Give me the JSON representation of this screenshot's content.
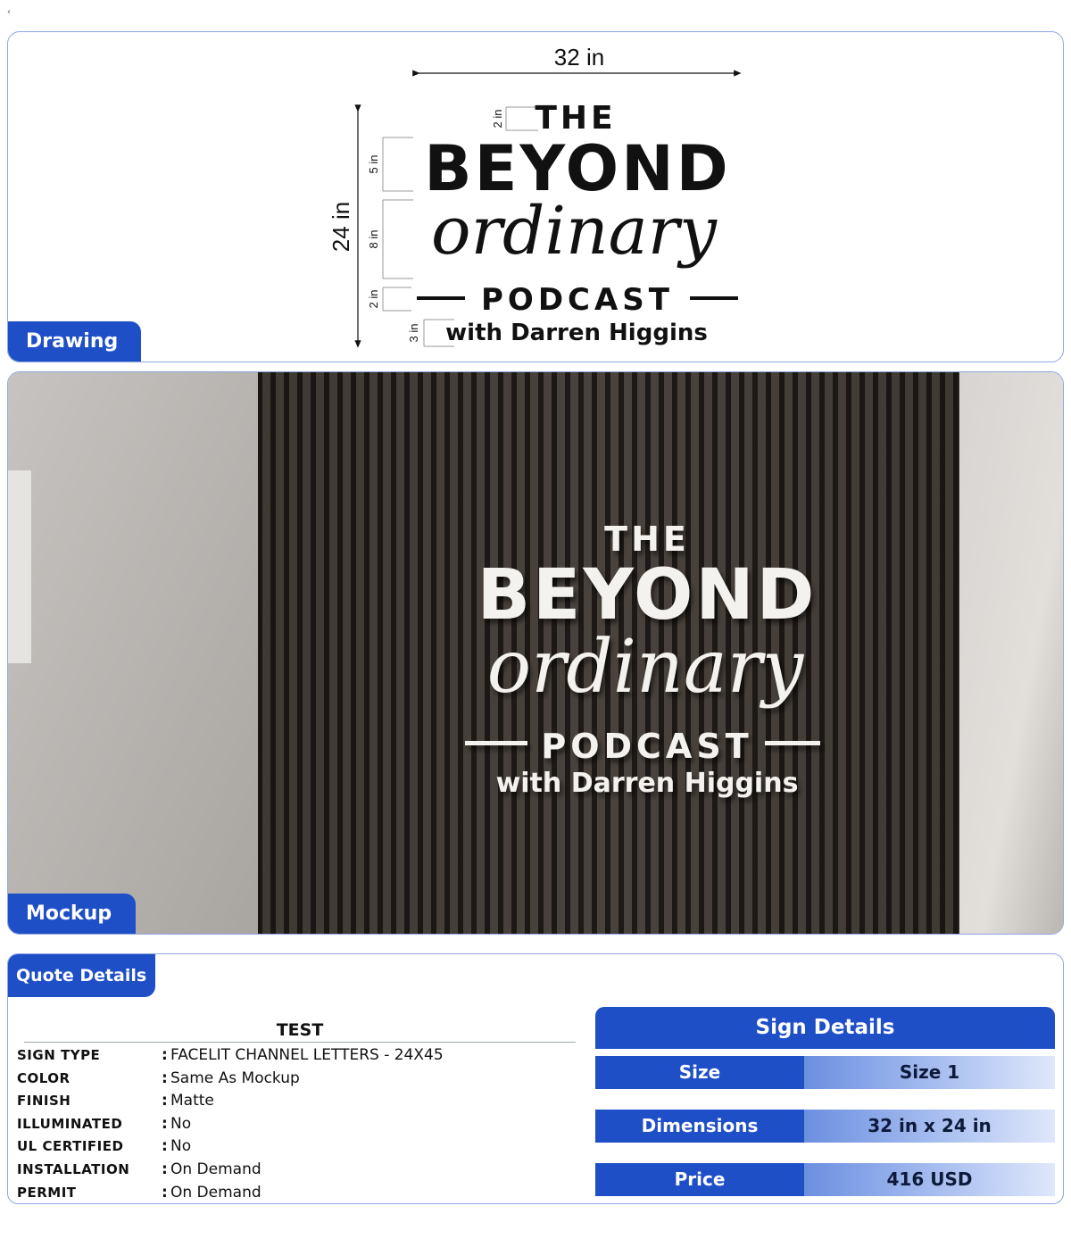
{
  "nav": {
    "back_glyph": "‹"
  },
  "drawing": {
    "tab_label": "Drawing",
    "width_label": "32 in",
    "height_label": "24 in",
    "row_dims": [
      "2 in",
      "5 in",
      "8 in",
      "2 in",
      "3 in"
    ],
    "logo": {
      "the": "THE",
      "beyond": "BEYOND",
      "script": "ordinary",
      "podcast": "PODCAST",
      "byline": "with Darren Higgins"
    }
  },
  "mockup": {
    "tab_label": "Mockup",
    "logo": {
      "the": "THE",
      "beyond": "BEYOND",
      "script": "ordinary",
      "podcast": "PODCAST",
      "byline": "with Darren Higgins"
    },
    "colors": {
      "wall": "#c9c5c2",
      "panel": "#3e3833",
      "slat": "#1e1a17",
      "letters": "#f4f2ee"
    }
  },
  "quote": {
    "tab_label": "Quote Details",
    "title": "TEST",
    "rows": [
      {
        "label": "SIGN TYPE",
        "value": "FACELIT CHANNEL LETTERS - 24X45"
      },
      {
        "label": "COLOR",
        "value": "Same As Mockup"
      },
      {
        "label": "FINISH",
        "value": "Matte"
      },
      {
        "label": "ILLUMINATED",
        "value": "No"
      },
      {
        "label": "UL CERTIFIED",
        "value": "No"
      },
      {
        "label": "INSTALLATION",
        "value": "On Demand"
      },
      {
        "label": "PERMIT",
        "value": "On Demand"
      }
    ],
    "colon": ":"
  },
  "sign_details": {
    "header": "Sign Details",
    "rows": [
      {
        "key": "Size",
        "value": "Size 1"
      },
      {
        "key": "Dimensions",
        "value": "32 in x 24 in"
      },
      {
        "key": "Price",
        "value": "416 USD"
      }
    ]
  },
  "colors": {
    "accent": "#1f4fc7",
    "panel_border": "#8fa6e0"
  }
}
